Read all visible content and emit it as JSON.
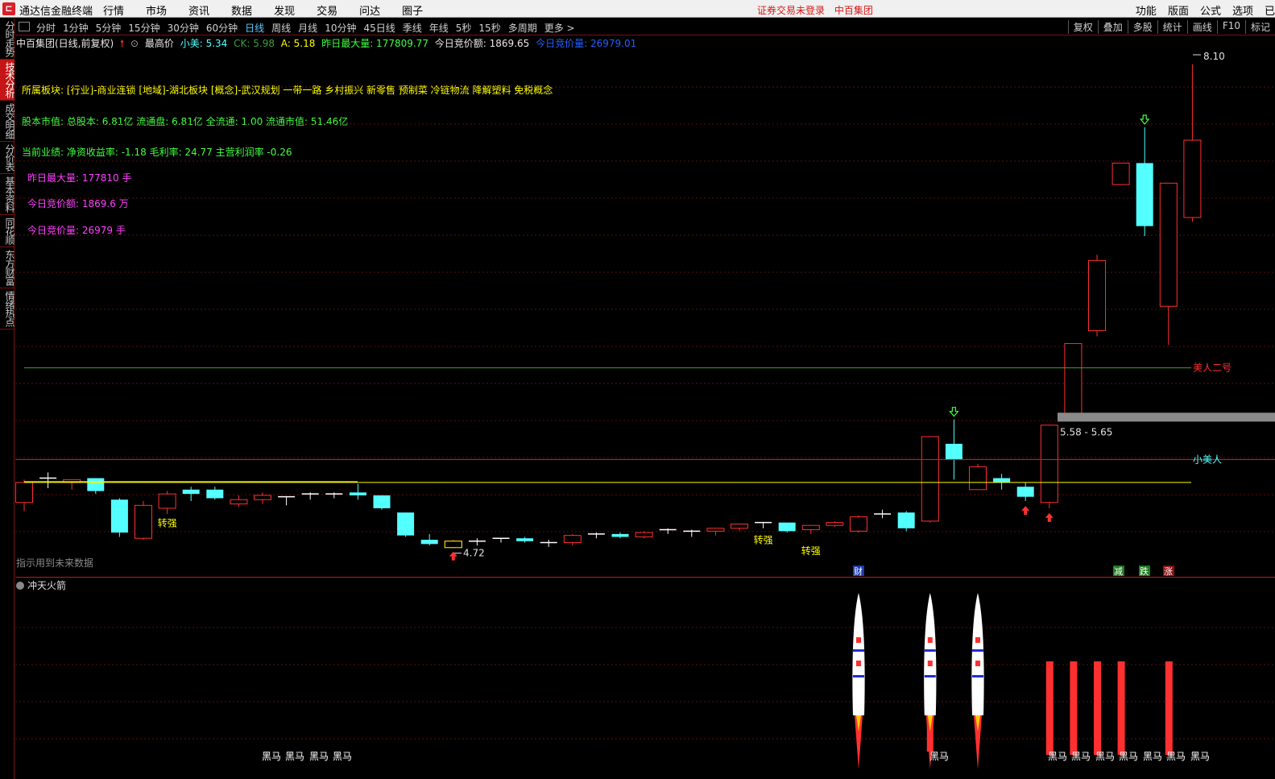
{
  "menubar": {
    "app_title": "通达信金融终端",
    "menus": [
      "行情",
      "市场",
      "资讯",
      "数据",
      "发现",
      "交易",
      "问达",
      "圈子"
    ],
    "notice": [
      "证券交易未登录",
      "中百集团"
    ],
    "right_menus": [
      "功能",
      "版面",
      "公式",
      "选项",
      "已"
    ]
  },
  "sidebar": {
    "tabs": [
      "分时走势",
      "技术分析",
      "成交明细",
      "分价表",
      "基本资料",
      "同花顺",
      "东方财富",
      "情绪热点"
    ],
    "active_index": 1
  },
  "periodbar": {
    "periods": [
      "分时",
      "1分钟",
      "5分钟",
      "15分钟",
      "30分钟",
      "60分钟",
      "日线",
      "周线",
      "月线",
      "10分钟",
      "45日线",
      "季线",
      "年线",
      "5秒",
      "15秒",
      "多周期",
      "更多 >"
    ],
    "active": "日线",
    "tools": [
      "复权",
      "叠加",
      "多股",
      "统计",
      "画线",
      "F10",
      "标记"
    ]
  },
  "infoline": {
    "stock": "中百集团(日线,前复权)",
    "highest_label": "最高价",
    "xiaomei": "小美: 5.34",
    "ck": "CK: 5.98",
    "a": "A: 5.18",
    "max_vol": "昨日最大量: 177809.77",
    "bid_amount": "今日竞价额: 1869.65",
    "bid_vol": "今日竞价量: 26979.01"
  },
  "overlay": {
    "sectors": "所属板块: [行业]-商业连锁 [地域]-湖北板块 [概念]-武汉规划 一带一路 乡村振兴 新零售 预制菜 冷链物流 降解塑料 免税概念",
    "equity": "股本市值: 总股本: 6.81亿 流通盘: 6.81亿 全流通: 1.00 流通市值: 51.46亿",
    "performance": "当前业绩: 净资收益率: -1.18 毛利率: 24.77 主营利润率 -0.26",
    "max_vol": "昨日最大量: 177810 手",
    "bid_amount": "今日竞价额: 1869.6 万",
    "bid_vol": "今日竞价量: 26979 手",
    "future_warning": "指示用到未来数据",
    "label_meiren2": "美人二号",
    "label_xiaomeiren": "小美人",
    "range_label": "5.58 - 5.65",
    "high_label": "8.10",
    "low_label": "4.72",
    "zhuanqiang": "转强",
    "cai": "财",
    "jian": "减",
    "die": "跌",
    "zhang": "涨"
  },
  "sub_chart": {
    "title": "冲天火箭",
    "heima": "黑马"
  },
  "colors": {
    "up": "#ff3030",
    "down": "#54ffff",
    "yellow": "#ffff00",
    "green_line": "#3ca03c",
    "red_line": "#d81818",
    "magenta": "#ff40ff"
  },
  "chart_data": {
    "type": "candlestick",
    "price_range": [
      4.6,
      8.2
    ],
    "candles": [
      {
        "o": 5.04,
        "h": 5.2,
        "l": 4.98,
        "c": 5.18
      },
      {
        "o": 5.2,
        "h": 5.25,
        "l": 5.14,
        "c": 5.21
      },
      {
        "o": 5.18,
        "h": 5.2,
        "l": 5.13,
        "c": 5.2
      },
      {
        "o": 5.21,
        "h": 5.21,
        "l": 5.1,
        "c": 5.12
      },
      {
        "o": 5.06,
        "h": 5.07,
        "l": 4.8,
        "c": 4.83
      },
      {
        "o": 4.79,
        "h": 5.05,
        "l": 4.78,
        "c": 5.02
      },
      {
        "o": 5.0,
        "h": 5.12,
        "l": 4.96,
        "c": 5.1
      },
      {
        "o": 5.13,
        "h": 5.15,
        "l": 5.05,
        "c": 5.1
      },
      {
        "o": 5.13,
        "h": 5.15,
        "l": 5.06,
        "c": 5.07
      },
      {
        "o": 5.03,
        "h": 5.09,
        "l": 5.01,
        "c": 5.06
      },
      {
        "o": 5.06,
        "h": 5.11,
        "l": 5.03,
        "c": 5.09
      },
      {
        "o": 5.08,
        "h": 5.08,
        "l": 5.02,
        "c": 5.08
      },
      {
        "o": 5.1,
        "h": 5.11,
        "l": 5.06,
        "c": 5.1
      },
      {
        "o": 5.1,
        "h": 5.11,
        "l": 5.07,
        "c": 5.09
      },
      {
        "o": 5.11,
        "h": 5.17,
        "l": 5.06,
        "c": 5.09
      },
      {
        "o": 5.09,
        "h": 5.09,
        "l": 4.99,
        "c": 5.0
      },
      {
        "o": 4.97,
        "h": 4.97,
        "l": 4.8,
        "c": 4.81
      },
      {
        "o": 4.78,
        "h": 4.82,
        "l": 4.74,
        "c": 4.75
      },
      {
        "o": 4.73,
        "h": 4.78,
        "l": 4.72,
        "c": 4.77
      },
      {
        "o": 4.77,
        "h": 4.79,
        "l": 4.74,
        "c": 4.77
      },
      {
        "o": 4.78,
        "h": 4.79,
        "l": 4.76,
        "c": 4.79
      },
      {
        "o": 4.79,
        "h": 4.8,
        "l": 4.76,
        "c": 4.77
      },
      {
        "o": 4.76,
        "h": 4.78,
        "l": 4.73,
        "c": 4.75
      },
      {
        "o": 4.76,
        "h": 4.82,
        "l": 4.74,
        "c": 4.81
      },
      {
        "o": 4.82,
        "h": 4.83,
        "l": 4.79,
        "c": 4.82
      },
      {
        "o": 4.82,
        "h": 4.83,
        "l": 4.79,
        "c": 4.8
      },
      {
        "o": 4.8,
        "h": 4.84,
        "l": 4.79,
        "c": 4.83
      },
      {
        "o": 4.84,
        "h": 4.86,
        "l": 4.82,
        "c": 4.85
      },
      {
        "o": 4.84,
        "h": 4.85,
        "l": 4.8,
        "c": 4.84
      },
      {
        "o": 4.84,
        "h": 4.86,
        "l": 4.81,
        "c": 4.86
      },
      {
        "o": 4.86,
        "h": 4.89,
        "l": 4.84,
        "c": 4.89
      },
      {
        "o": 4.9,
        "h": 4.9,
        "l": 4.86,
        "c": 4.89
      },
      {
        "o": 4.9,
        "h": 4.9,
        "l": 4.83,
        "c": 4.84
      },
      {
        "o": 4.85,
        "h": 4.88,
        "l": 4.82,
        "c": 4.88
      },
      {
        "o": 4.88,
        "h": 4.91,
        "l": 4.87,
        "c": 4.9
      },
      {
        "o": 4.84,
        "h": 4.95,
        "l": 4.83,
        "c": 4.94
      },
      {
        "o": 4.96,
        "h": 4.99,
        "l": 4.93,
        "c": 4.96
      },
      {
        "o": 4.97,
        "h": 4.98,
        "l": 4.84,
        "c": 4.86
      },
      {
        "o": 4.91,
        "h": 5.5,
        "l": 4.9,
        "c": 5.5
      },
      {
        "o": 5.45,
        "h": 5.62,
        "l": 5.2,
        "c": 5.34
      },
      {
        "o": 5.13,
        "h": 5.31,
        "l": 5.13,
        "c": 5.29
      },
      {
        "o": 5.21,
        "h": 5.24,
        "l": 5.13,
        "c": 5.18
      },
      {
        "o": 5.15,
        "h": 5.18,
        "l": 5.05,
        "c": 5.08
      },
      {
        "o": 5.04,
        "h": 5.58,
        "l": 5.0,
        "c": 5.58
      },
      {
        "o": 5.65,
        "h": 6.15,
        "l": 5.65,
        "c": 6.15
      },
      {
        "o": 6.24,
        "h": 6.77,
        "l": 6.2,
        "c": 6.73
      },
      {
        "o": 7.26,
        "h": 7.41,
        "l": 7.26,
        "c": 7.41
      },
      {
        "o": 7.41,
        "h": 7.66,
        "l": 6.9,
        "c": 6.97
      },
      {
        "o": 6.41,
        "h": 7.27,
        "l": 6.14,
        "c": 7.27
      },
      {
        "o": 7.03,
        "h": 8.1,
        "l": 7.0,
        "c": 7.57
      }
    ]
  }
}
